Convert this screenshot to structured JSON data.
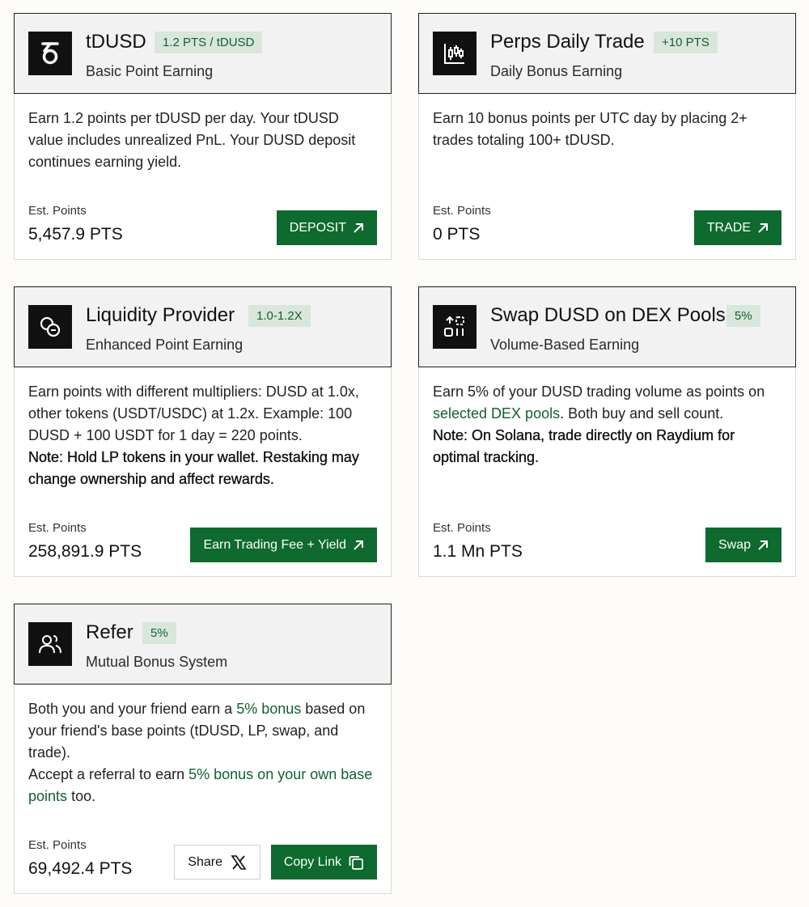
{
  "cards": [
    {
      "title": "tDUSD",
      "tag": "1.2 PTS / tDUSD",
      "subtitle": "Basic Point Earning",
      "desc_1": "Earn 1.2 points per tDUSD per day. Your tDUSD value includes unrealized PnL. Your DUSD deposit continues earning yield.",
      "est_label": "Est. Points",
      "est_value": "5,457.9 PTS",
      "button": "DEPOSIT",
      "icon": "tdusd-logo-icon"
    },
    {
      "title": "Perps Daily Trade",
      "tag": "+10 PTS",
      "subtitle": "Daily Bonus Earning",
      "desc_1": "Earn 10 bonus points per UTC day by placing 2+ trades totaling 100+ tDUSD.",
      "est_label": "Est. Points",
      "est_value": "0 PTS",
      "button": "TRADE",
      "icon": "candlestick-chart-icon"
    },
    {
      "title": "Liquidity Provider",
      "tag": "1.0-1.2X",
      "subtitle": "Enhanced Point Earning",
      "desc_1": "Earn points with different multipliers: DUSD at 1.0x, other tokens (USDT/USDC) at 1.2x. Example: 100 DUSD + 100 USDT for 1 day = 220 points.",
      "note": "Note: Hold LP tokens in your wallet. Restaking may change ownership and affect rewards.",
      "est_label": "Est. Points",
      "est_value": "258,891.9 PTS",
      "button": "Earn Trading Fee + Yield",
      "icon": "coins-icon"
    },
    {
      "title": "Swap DUSD on DEX Pools",
      "tag": "5%",
      "subtitle": "Volume-Based Earning",
      "desc_1_hl": "Earn 5% of your DUSD trading volume as points on",
      "desc_1_link": "selected DEX pools",
      "desc_1_tail": ". Both buy and sell count.",
      "note": "Note: On Solana, trade directly on Raydium for optimal tracking.",
      "est_label": "Est. Points",
      "est_value": "1.1 Mn PTS",
      "button": "Swap",
      "icon": "swap-icon"
    },
    {
      "title": "Refer",
      "tag": "5%",
      "subtitle": "Mutual Bonus System",
      "desc_a": "Both you and your friend earn a",
      "desc_b": "5% bonus",
      "desc_c": "based on your friend's base points (tDUSD, LP, swap, and trade).",
      "desc_d": "Accept a referral to earn",
      "desc_e": "5% bonus on your own base points",
      "desc_f": "too.",
      "est_label": "Est. Points",
      "est_value": "69,492.4 PTS",
      "share": "Share",
      "button": "Copy Link",
      "icon": "users-icon"
    }
  ]
}
